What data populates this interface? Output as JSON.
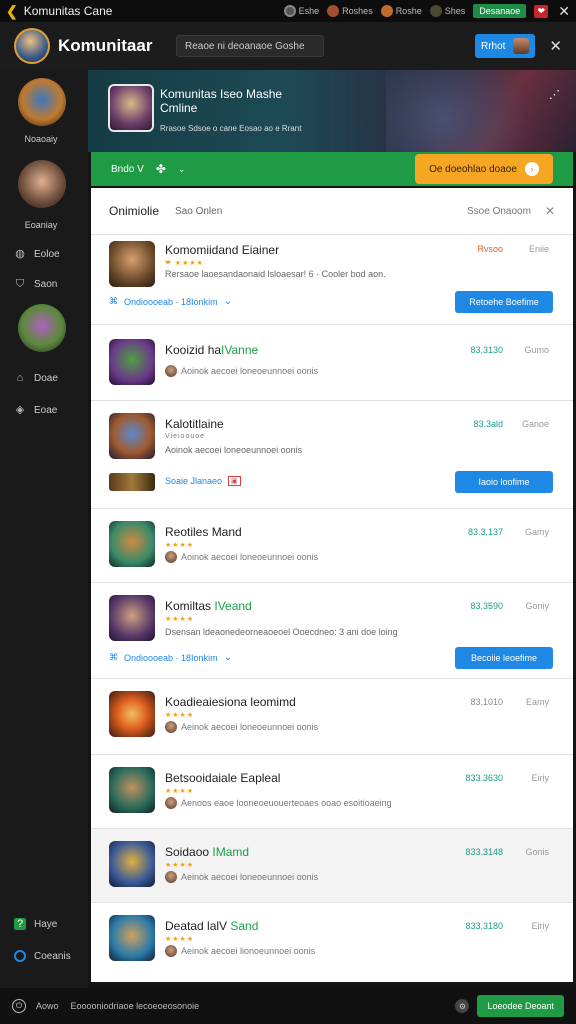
{
  "topbar": {
    "title": "Komunitas Cane",
    "chips": [
      "Eshe",
      "Roshes",
      "Roshe",
      "Shes"
    ],
    "green_button": "Desanaoe",
    "close": "✕"
  },
  "header": {
    "brand": "Komunitaar",
    "search_placeholder": "Reaoe ni deoanaoe Goshe",
    "button_label": "Rrhot",
    "close": "✕"
  },
  "sidebar": {
    "items": [
      {
        "label": "Noaoaiy"
      },
      {
        "label": "Eoaniay"
      },
      {
        "label": "Eoloe",
        "icon": "globe-icon"
      },
      {
        "label": "Saon",
        "icon": "shield-icon"
      },
      {
        "label": "Doae",
        "icon": "cart-icon"
      },
      {
        "label": "Eoae",
        "icon": "tag-icon"
      }
    ],
    "bottom": [
      {
        "label": "Haye",
        "icon": "help-icon"
      },
      {
        "label": "Coeanis",
        "icon": "circle-icon"
      }
    ]
  },
  "banner": {
    "title": "Komunitas Iseo Mashe Cmline",
    "subtitle": "Rrasoe Sdsoe o cane Eosao ao e Rrant",
    "dots": "⋰"
  },
  "filterbar": {
    "select": "Bndo V",
    "clover": "✤",
    "chevron": "⌄",
    "orange_button": "Oe doeohlao doaoe"
  },
  "panel": {
    "title": "Onimiolie",
    "tab2": "Sao Onlen",
    "right": "Ssoe Onaoom",
    "close": "✕"
  },
  "cards": [
    {
      "name": "Komomiidand Eiainer",
      "price": "Rvsoo",
      "type": "Eniie",
      "desc": "Rersaoe laoesandaonaid lsloaesar! 6 · Cooler bod aon.",
      "stars": "❤ ★★★★",
      "link": "Ondioooeab · 18Ionkim",
      "button": "Retoehe Boefime"
    },
    {
      "name": "Kooizid ha",
      "name_green": "IVanne",
      "price": "83.3130",
      "type": "Gumo",
      "stars": "★★★★",
      "meta": "Aoinok aecoei loneoeunnoei oonis"
    },
    {
      "name": "Kalotitlaine",
      "price": "83.3ald",
      "type": "Ganoe",
      "stars": "Vieioouoe",
      "meta": "Aoinok aecoei loneoeunnoei oonis",
      "tag": "Soaie Jlanaeo",
      "button": "Iaoio loofime"
    },
    {
      "name": "Reotiles Mand",
      "price": "83.3,137",
      "type": "Gamy",
      "stars": "★★★★",
      "meta": "Aoinok aecoei loneoeunnoei oonis"
    },
    {
      "name": "Komiltas ",
      "name_green": "IVeand",
      "price": "83.3590",
      "type": "Goniy",
      "stars": "★★★★",
      "desc": "Dsensan ldeaonedeorneaoeoel Ooecdneo: 3 ani doe loing",
      "link": "Ondioooeab · 18Ionkim",
      "button": "Becoiie leoefime"
    },
    {
      "name": "Koadieaiesiona leomimd",
      "price": "83.1010",
      "type": "Eamy",
      "stars": "★★★★",
      "meta": "Aeinok aecoei loneoeunnoei oonis"
    },
    {
      "name": "Betsooidaiale Eapleal",
      "price": "833.3630",
      "type": "Eiriy",
      "stars": "★★★★",
      "meta": "Aenoos eaoe looneoeuouerteoaes ooao esoitioaeing"
    },
    {
      "name": "Soidaoo ",
      "name_green": "IMamd",
      "price": "833.3148",
      "type": "Gonis",
      "stars": "★★★★",
      "meta": "Aeinok aecoei loneoeunnoei oonis"
    },
    {
      "name": "Deatad lalV ",
      "name_green": "Sand",
      "price": "833.3180",
      "type": "Eiriy",
      "stars": "★★★★",
      "meta": "Aeinok aecoei lionoeunnoei oonis"
    }
  ],
  "footer": {
    "status": "Aowo",
    "description": "Eooooniodriaoe lecoeoeosonoie",
    "button": "Loeodee Deoant"
  },
  "colors": {
    "accent_blue": "#1e88e5",
    "green": "#1f9b45",
    "orange": "#f5a623",
    "price_teal": "#1a9e8a"
  }
}
